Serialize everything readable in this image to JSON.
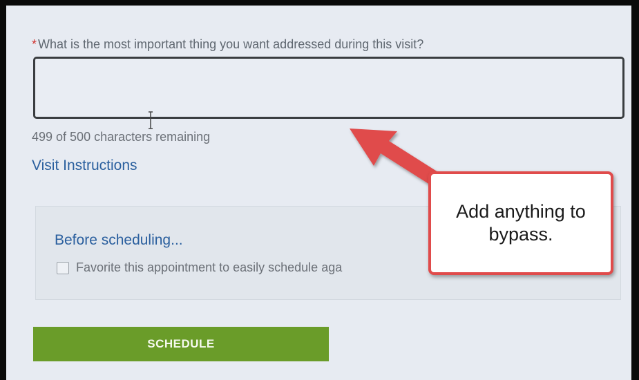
{
  "form": {
    "required_marker": "*",
    "question_label": "What is the most important thing you want addressed during this visit?",
    "answer_value": "",
    "char_count_text": "499 of 500 characters remaining",
    "visit_instructions_link": "Visit Instructions"
  },
  "before_scheduling": {
    "title": "Before scheduling...",
    "favorite_checked": false,
    "favorite_label": "Favorite this appointment to easily schedule aga"
  },
  "actions": {
    "schedule_label": "SCHEDULE"
  },
  "annotation": {
    "callout_text": "Add anything to bypass.",
    "color": "#e04b4b"
  },
  "colors": {
    "background": "#e7ebf2",
    "link": "#2a5f9e",
    "schedule_button": "#6a9c29",
    "required": "#d0312d"
  }
}
